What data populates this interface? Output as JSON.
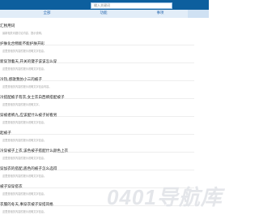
{
  "search": {
    "placeholder": "输入关键词"
  },
  "nav": {
    "items": [
      {
        "label": "全部"
      },
      {
        "label": "功能"
      },
      {
        "label": "事项"
      }
    ]
  },
  "list": [
    {
      "title": "汇税用词",
      "sub": "最新相关问题讨论内容，提示说明。"
    },
    {
      "title": "护肤化合物能不能护肤开彩",
      "sub": "这里是相关内容的提示说明文字信息。"
    },
    {
      "title": "新穿顶着天,开关的键子该该怎么穿",
      "sub": "这里是相关内容的提示说明文字信息。"
    },
    {
      "title": "冷热,感歌我仿小三的被子",
      "sub": "这里是相关内容的提示说明文字信息内容。"
    },
    {
      "title": "冷搭配被子有衣,女士衣白西裤搭配被子",
      "sub": "这里是相关内容的提示说明文字。"
    },
    {
      "title": "穿被者裤九,应该配什么被子好看男",
      "sub": "这里是相关内容的提示说明文字信息。"
    },
    {
      "title": "起被子",
      "sub": "这里是相关内容的提示说明文字信息。"
    },
    {
      "title": "冷穿被子上衣,该色被子搭配什么颜色上衣",
      "sub": "这里是相关内容的提示说明文字信息。"
    },
    {
      "title": "穿加衣的搭配,底色的被子怎么选得",
      "sub": "这里是相关内容的提示说明文字信息。"
    },
    {
      "title": "被子穿穿搭衣",
      "sub": "这里是相关内容的提示说明文字信息。"
    },
    {
      "title": "衣服的冬天,事穿衣被子穿搭风格",
      "sub": "这里是相关内容的提示说明文字信息。"
    }
  ],
  "watermark": {
    "text": "0401导航库"
  }
}
